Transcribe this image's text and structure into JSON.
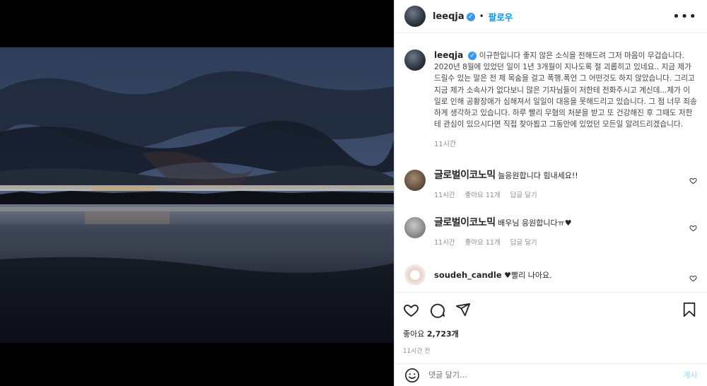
{
  "header": {
    "username": "leeqja",
    "verified_mark": "✓",
    "separator": "•",
    "follow_label": "팔로우",
    "more_label": "•••"
  },
  "caption": {
    "username": "leeqja",
    "text": "이규한입니다 좋지 않은 소식을 전해드려 그저 마음이 무겁습니다. 2020년 8월에 있었던 일이 1년 3개월이 지나도록 절 괴롭히고 있네요.. 지금 제가 드릴수 있는 말은 전 제 목숨을 걸고 폭행.폭언 그 어떤것도 하지 않았습니다. 그리고 지금 제가 소속사가 없다보니 많은 기자님들이 저한테 전화주시고 계신데...제가 이 일로 인해 공황장애가 심해져서 일일이 대응을 못해드리고 있습니다. 그 점 너무 죄송하게 생각하고 있습니다. 하루 빨리 무혐의 처분을 받고 또 건강해진 후 그때도 저한테 관심이 있으시다면 직접 찾아뵙고 그동안에 있었던 모든일 알려드리겠습니다.",
    "time": "11시간"
  },
  "comments": [
    {
      "overlay_name": "글로벌이코노믹",
      "text": "늘응원합니다 힘내세요!!",
      "time": "11시간",
      "likes": "좋아요 11개",
      "reply": "답글 달기"
    },
    {
      "overlay_name": "글로벌이코노믹",
      "text": "배우님 응원합니다ㅠ♥",
      "time": "11시간",
      "likes": "좋아요 11개",
      "reply": "답글 달기"
    },
    {
      "username": "soudeh_candle",
      "text": "♥빨리 나아요."
    }
  ],
  "icons": {
    "like": "heart-icon",
    "comment": "comment-icon",
    "share": "share-icon",
    "save": "bookmark-icon",
    "more": "more-icon",
    "emoji": "emoji-icon"
  },
  "likes": {
    "label": "좋아요",
    "count": "2,723개"
  },
  "post_time": "11시간 전",
  "composer": {
    "placeholder": "댓글 달기...",
    "post_label": "게시"
  },
  "colors": {
    "accent": "#0095f6",
    "heart_red": "#ed4956",
    "muted": "#8e8e8e"
  }
}
